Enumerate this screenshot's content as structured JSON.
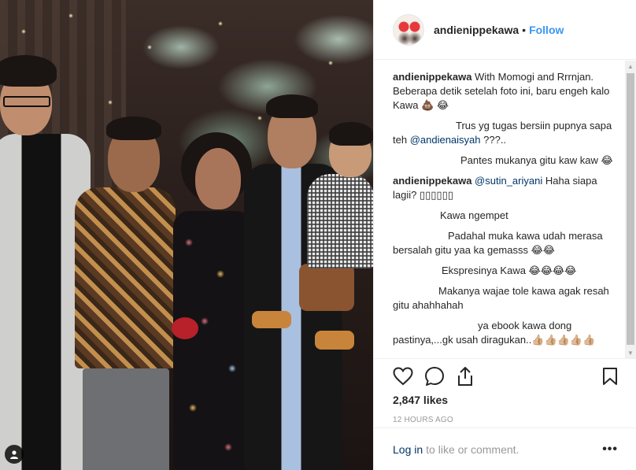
{
  "post": {
    "username": "andienippekawa",
    "separator": "•",
    "follow_label": "Follow"
  },
  "comments": [
    {
      "author": "andienippekawa",
      "text": " With Momogi and Rrrnjan. Beberapa detik setelah foto ini, baru engeh kalo Kawa 💩 😂"
    },
    {
      "author": "",
      "text": "Trus yg tugas bersiin pupnya sapa teh ",
      "mention": "@andienaisyah",
      "after": " ???.."
    },
    {
      "author": "",
      "text": "Pantes mukanya gitu kaw kaw 😂"
    },
    {
      "author": "andienippekawa",
      "text": " ",
      "mention": "@sutin_ariyani",
      "after": " Haha siapa lagii? ▯▯▯▯▯▯"
    },
    {
      "author": "",
      "text": "Kawa ngempet"
    },
    {
      "author": "",
      "text": "Padahal muka kawa udah merasa bersalah gitu yaa ka gemasss 😂😂"
    },
    {
      "author": "",
      "text": "Ekspresinya Kawa 😂😂😂😂"
    },
    {
      "author": "",
      "text": "Makanya wajae tole kawa agak resah gitu ahahhahah"
    },
    {
      "author": "",
      "text": "ya ebook kawa dong pastinya,...gk usah diragukan..👍🏼👍🏼👍🏼👍🏼👍🏼"
    }
  ],
  "stats": {
    "likes": "2,847 likes",
    "time": "12 HOURS AGO"
  },
  "footer": {
    "login_label": "Log in",
    "login_rest": "to like or comment.",
    "more_label": "•••"
  },
  "icons": {
    "like": "heart-icon",
    "comment": "comment-icon",
    "share": "share-icon",
    "save": "bookmark-icon",
    "tag": "user-tag-icon"
  },
  "colors": {
    "link": "#3897f0",
    "mention": "#003569",
    "muted": "#999999"
  }
}
